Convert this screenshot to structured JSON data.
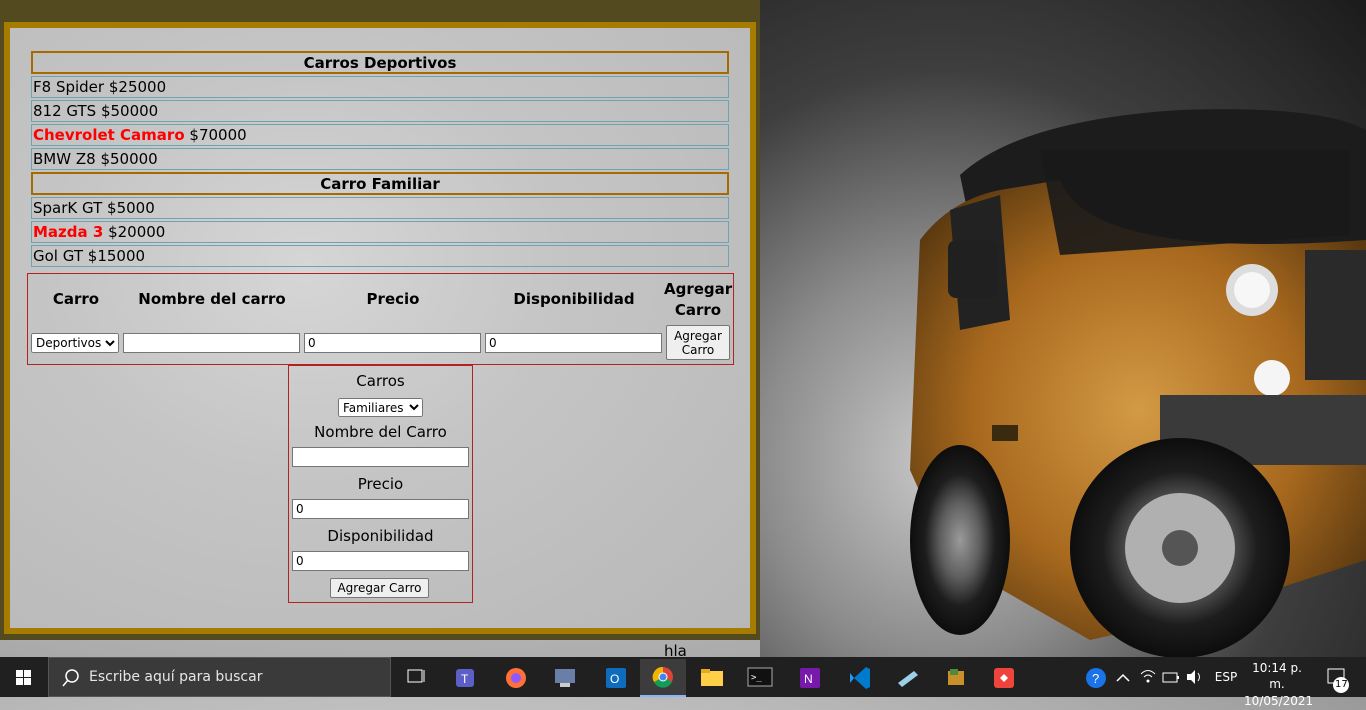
{
  "sections": [
    {
      "title": "Carros Deportivos",
      "items": [
        {
          "name": "F8 Spider",
          "price": "$25000",
          "highlight": false
        },
        {
          "name": "812 GTS",
          "price": "$50000",
          "highlight": false
        },
        {
          "name": "Chevrolet Camaro",
          "price": "$70000",
          "highlight": true
        },
        {
          "name": "BMW Z8",
          "price": "$50000",
          "highlight": false
        }
      ]
    },
    {
      "title": "Carro Familiar",
      "items": [
        {
          "name": "SparK GT",
          "price": "$5000",
          "highlight": false
        },
        {
          "name": "Mazda 3",
          "price": "$20000",
          "highlight": true
        },
        {
          "name": "Gol GT",
          "price": "$15000",
          "highlight": false
        }
      ]
    }
  ],
  "add_table": {
    "headers": {
      "carro": "Carro",
      "nombre": "Nombre del carro",
      "precio": "Precio",
      "disponibilidad": "Disponibilidad",
      "agregar": "Agregar Carro"
    },
    "carro_selected": "Deportivos",
    "nombre_value": "",
    "precio_value": "0",
    "disponibilidad_value": "0",
    "button_label": "Agregar Carro"
  },
  "form2": {
    "carros_label": "Carros",
    "carros_selected": "Familiares",
    "nombre_label": "Nombre del Carro",
    "nombre_value": "",
    "precio_label": "Precio",
    "precio_value": "0",
    "disponibilidad_label": "Disponibilidad",
    "disponibilidad_value": "0",
    "button_label": "Agregar Carro"
  },
  "footer_text": "hla",
  "taskbar": {
    "search_placeholder": "Escribe aquí para buscar",
    "language": "ESP",
    "time": "10:14 p. m.",
    "date": "10/05/2021",
    "notification_count": "17"
  },
  "colors": {
    "highlight": "#ff0000",
    "frame": "#a67c00",
    "table_border": "#b22222"
  }
}
